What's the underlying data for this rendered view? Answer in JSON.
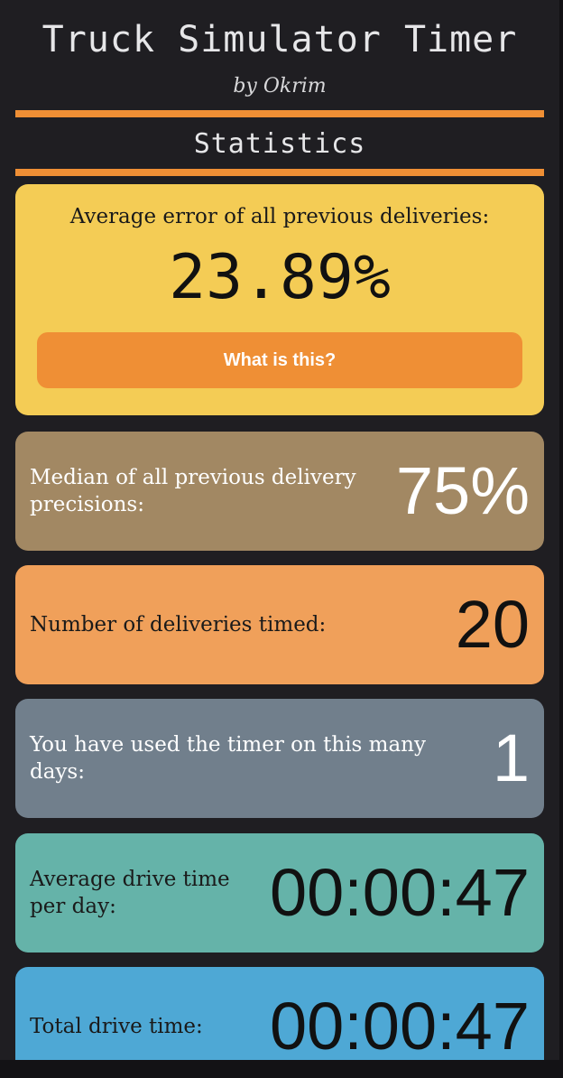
{
  "header": {
    "title": "Truck Simulator Timer",
    "subtitle": "by Okrim",
    "section_title": "Statistics"
  },
  "average_error": {
    "label": "Average error of all previous deliveries:",
    "value": "23.89%",
    "button_label": "What is this?"
  },
  "stats": {
    "median": {
      "label": "Median of all previous delivery precisions:",
      "value": "75%"
    },
    "deliveries": {
      "label": "Number of deliveries timed:",
      "value": "20"
    },
    "days": {
      "label": "You have used the timer on this many days:",
      "value": "1"
    },
    "avg_drive": {
      "label": "Average drive time per day:",
      "value": "00:00:47"
    },
    "total_drive": {
      "label": "Total drive time:",
      "value": "00:00:47"
    }
  },
  "colors": {
    "background": "#1f1e22",
    "accent": "#ef8f35",
    "avg_error_card": "#f4cc55",
    "median_card": "#a28863",
    "deliveries_card": "#f0a05a",
    "days_card": "#717f8c",
    "avg_drive_card": "#65b3a9",
    "total_drive_card": "#4ea8d5"
  }
}
